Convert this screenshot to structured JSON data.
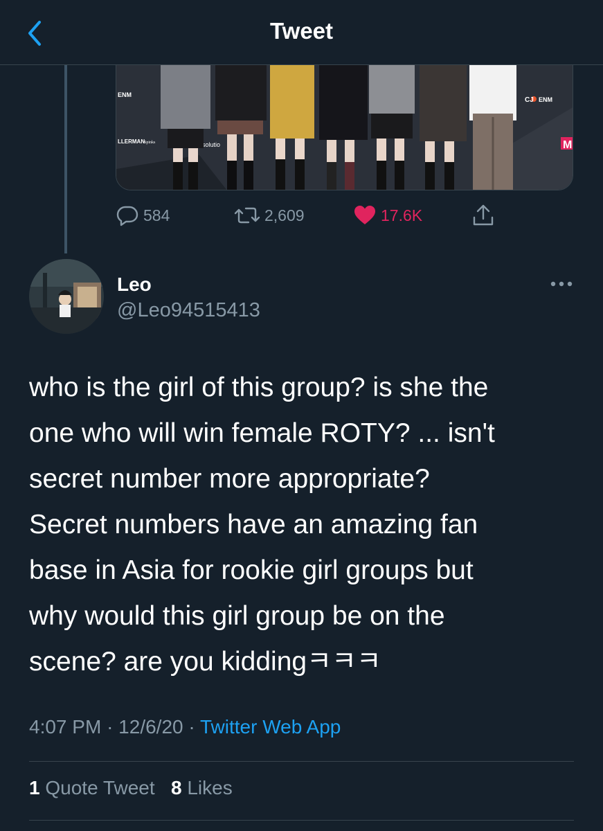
{
  "header": {
    "title": "Tweet",
    "back_icon": "chevron-left-icon"
  },
  "parent_tweet": {
    "media_texts": {
      "logo_enm": "ENM",
      "logo_cj": "CJ",
      "logo_cj_enm": "ENM",
      "logo_m": "M",
      "sponsor_left": "LLERMAN",
      "sponsor_left_small": "Spinks",
      "sponsor_solution": "solutio"
    },
    "actions": {
      "replies": "584",
      "retweets": "2,609",
      "likes": "17.6K"
    }
  },
  "tweet": {
    "author_name": "Leo",
    "author_handle": "@Leo94515413",
    "text_lines": [
      "who is the girl of this group? is she the",
      "one who will win female ROTY? ... isn't",
      "secret number more appropriate?",
      "Secret numbers have an amazing fan",
      "base in Asia for rookie girl groups but",
      "why would this girl group be on the",
      "scene? are you kiddingㅋㅋㅋ"
    ],
    "time": "4:07 PM",
    "date": "12/6/20",
    "separator": "·",
    "source": "Twitter Web App",
    "quote_tweets_count": "1",
    "quote_tweets_label": "Quote Tweet",
    "likes_count": "8",
    "likes_label": "Likes"
  },
  "colors": {
    "background": "#15202b",
    "divider": "#38444d",
    "secondary_text": "#8899a6",
    "accent_blue": "#1da1f2",
    "like_red": "#e0245e"
  }
}
